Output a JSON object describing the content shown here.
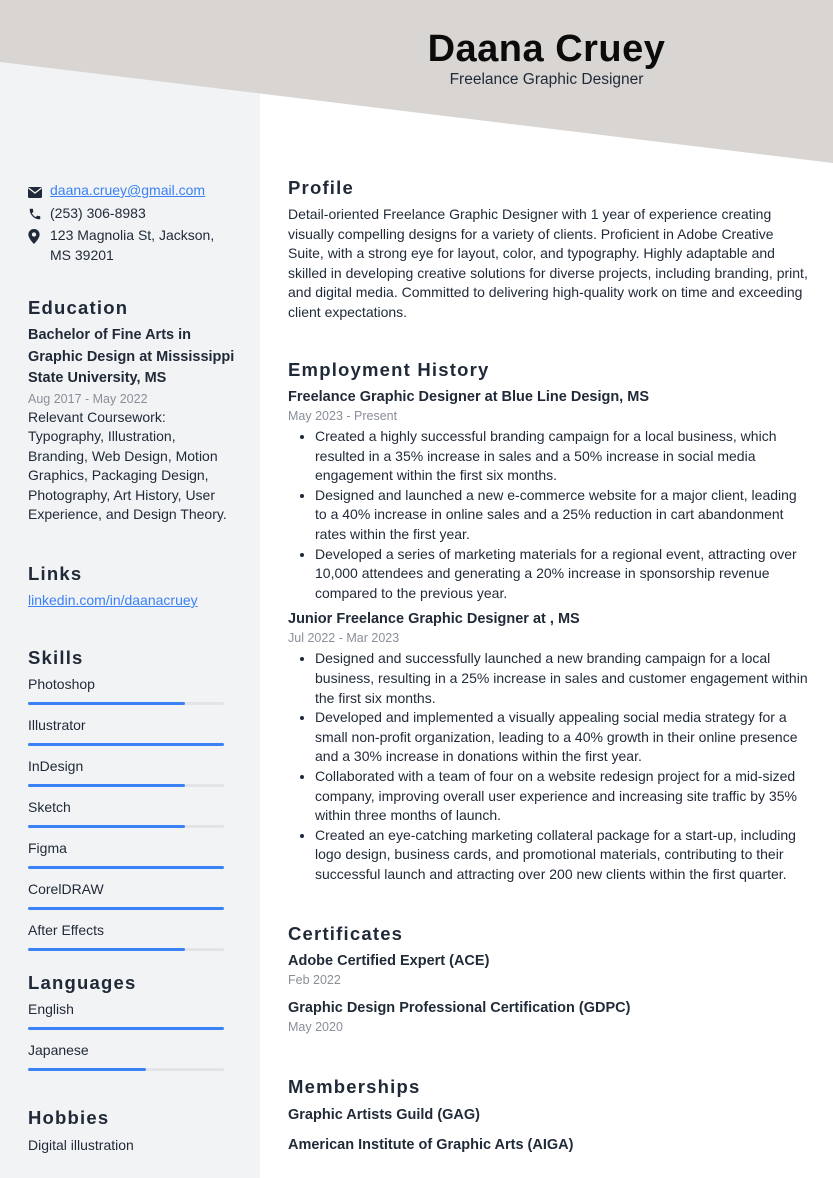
{
  "header": {
    "name": "Daana Cruey",
    "title": "Freelance Graphic Designer"
  },
  "colors": {
    "accent": "#3b82f6",
    "header_band": "#d8d5d2",
    "sidebar_bg": "#f2f3f5"
  },
  "contact": {
    "email": "daana.cruey@gmail.com",
    "phone": "(253) 306-8983",
    "address": "123 Magnolia St, Jackson, MS 39201"
  },
  "education": {
    "heading": "Education",
    "degree": "Bachelor of Fine Arts in Graphic Design at Mississippi State University, MS",
    "dates": "Aug 2017 - May 2022",
    "description": "Relevant Coursework: Typography, Illustration, Branding, Web Design, Motion Graphics, Packaging Design, Photography, Art History, User Experience, and Design Theory."
  },
  "links": {
    "heading": "Links",
    "items": [
      "linkedin.com/in/daanacruey"
    ]
  },
  "skills": {
    "heading": "Skills",
    "items": [
      {
        "name": "Photoshop",
        "level": 0.8
      },
      {
        "name": "Illustrator",
        "level": 1.0
      },
      {
        "name": "InDesign",
        "level": 0.8
      },
      {
        "name": "Sketch",
        "level": 0.8
      },
      {
        "name": "Figma",
        "level": 1.0
      },
      {
        "name": "CorelDRAW",
        "level": 1.0
      },
      {
        "name": "After Effects",
        "level": 0.8
      }
    ]
  },
  "languages": {
    "heading": "Languages",
    "items": [
      {
        "name": "English",
        "level": 1.0
      },
      {
        "name": "Japanese",
        "level": 0.6
      }
    ]
  },
  "hobbies": {
    "heading": "Hobbies",
    "items": [
      "Digital illustration"
    ]
  },
  "profile": {
    "heading": "Profile",
    "text": "Detail-oriented Freelance Graphic Designer with 1 year of experience creating visually compelling designs for a variety of clients. Proficient in Adobe Creative Suite, with a strong eye for layout, color, and typography. Highly adaptable and skilled in developing creative solutions for diverse projects, including branding, print, and digital media. Committed to delivering high-quality work on time and exceeding client expectations."
  },
  "employment": {
    "heading": "Employment History",
    "jobs": [
      {
        "title": "Freelance Graphic Designer at Blue Line Design, MS",
        "dates": "May 2023 - Present",
        "bullets": [
          "Created a highly successful branding campaign for a local business, which resulted in a 35% increase in sales and a 50% increase in social media engagement within the first six months.",
          "Designed and launched a new e-commerce website for a major client, leading to a 40% increase in online sales and a 25% reduction in cart abandonment rates within the first year.",
          "Developed a series of marketing materials for a regional event, attracting over 10,000 attendees and generating a 20% increase in sponsorship revenue compared to the previous year."
        ]
      },
      {
        "title": "Junior Freelance Graphic Designer at , MS",
        "dates": "Jul 2022 - Mar 2023",
        "bullets": [
          "Designed and successfully launched a new branding campaign for a local business, resulting in a 25% increase in sales and customer engagement within the first six months.",
          "Developed and implemented a visually appealing social media strategy for a small non-profit organization, leading to a 40% growth in their online presence and a 30% increase in donations within the first year.",
          "Collaborated with a team of four on a website redesign project for a mid-sized company, improving overall user experience and increasing site traffic by 35% within three months of launch.",
          "Created an eye-catching marketing collateral package for a start-up, including logo design, business cards, and promotional materials, contributing to their successful launch and attracting over 200 new clients within the first quarter."
        ]
      }
    ]
  },
  "certificates": {
    "heading": "Certificates",
    "items": [
      {
        "name": "Adobe Certified Expert (ACE)",
        "date": "Feb 2022"
      },
      {
        "name": "Graphic Design Professional Certification (GDPC)",
        "date": "May 2020"
      }
    ]
  },
  "memberships": {
    "heading": "Memberships",
    "items": [
      "Graphic Artists Guild (GAG)",
      "American Institute of Graphic Arts (AIGA)"
    ]
  }
}
